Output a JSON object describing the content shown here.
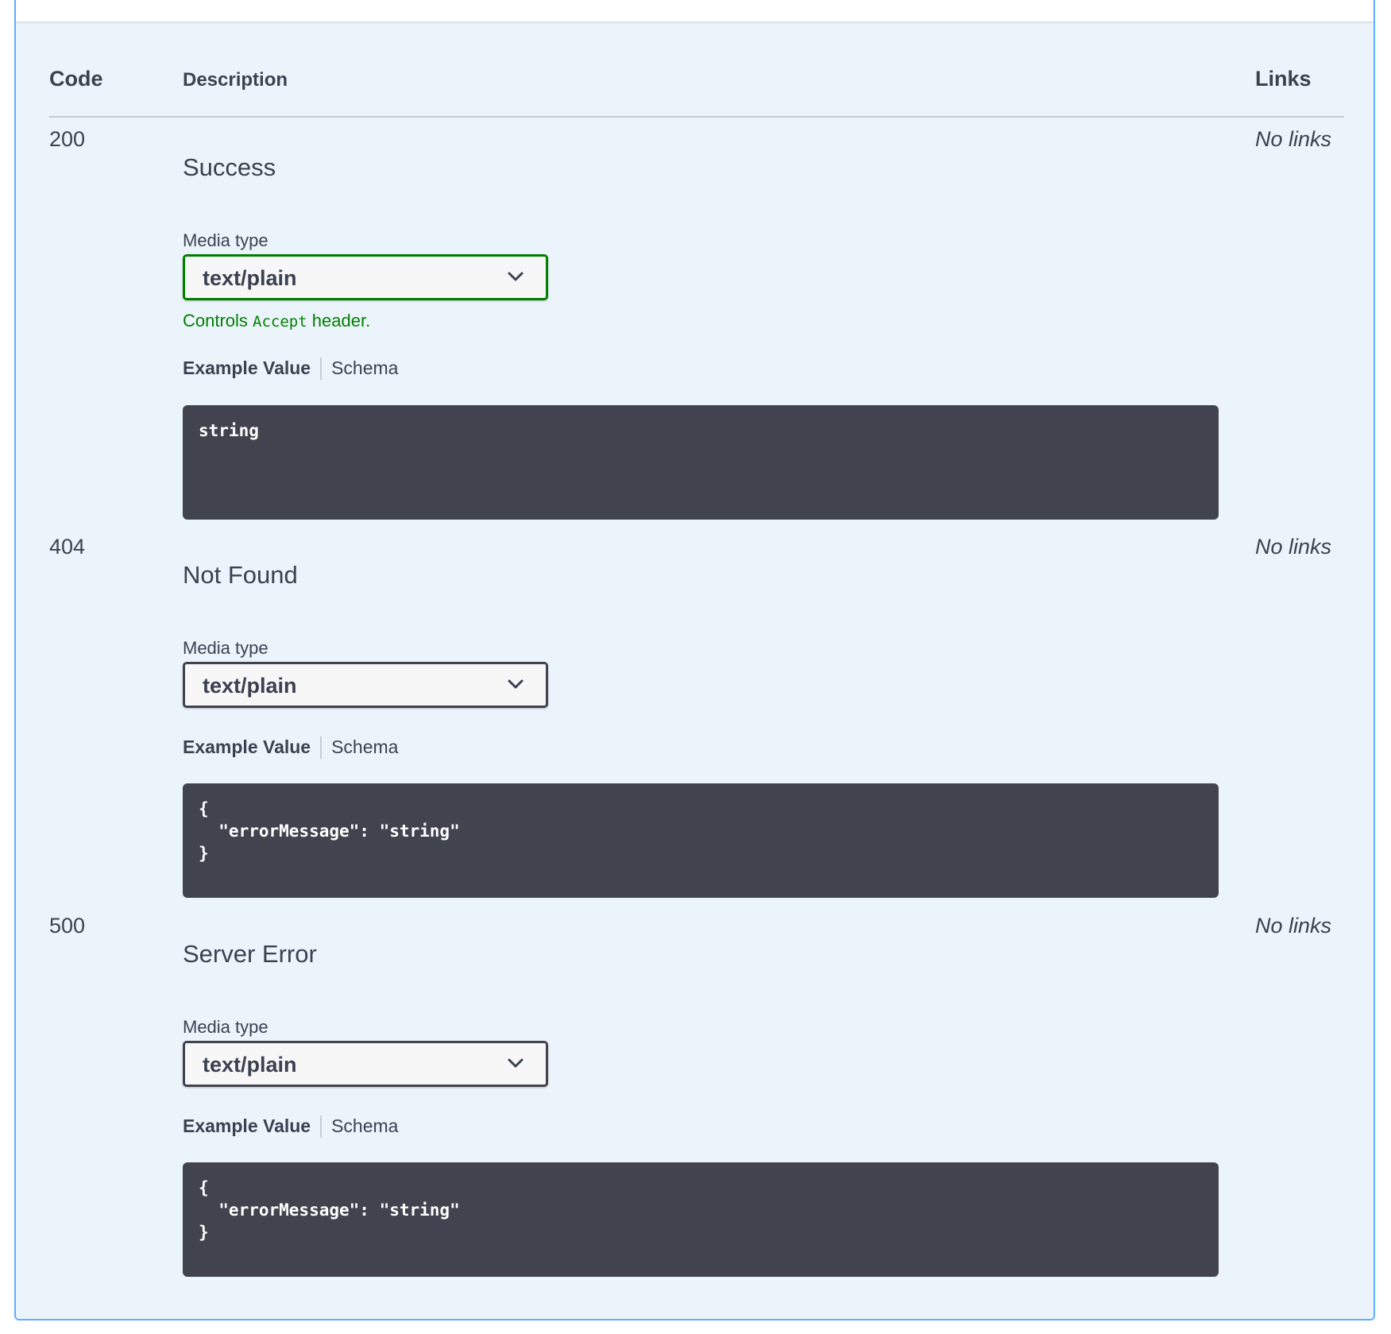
{
  "table": {
    "headers": {
      "code": "Code",
      "description": "Description",
      "links": "Links"
    }
  },
  "responses": [
    {
      "code": "200",
      "description": "Success",
      "links": "No links",
      "media_type_label": "Media type",
      "media_type_value": "text/plain",
      "media_type_active": true,
      "controls_note": {
        "before": "Controls ",
        "code": "Accept",
        "after": " header."
      },
      "tabs": [
        "Example Value",
        "Schema"
      ],
      "example": "string"
    },
    {
      "code": "404",
      "description": "Not Found",
      "links": "No links",
      "media_type_label": "Media type",
      "media_type_value": "text/plain",
      "media_type_active": false,
      "tabs": [
        "Example Value",
        "Schema"
      ],
      "example": "{\n  \"errorMessage\": \"string\"\n}"
    },
    {
      "code": "500",
      "description": "Server Error",
      "links": "No links",
      "media_type_label": "Media type",
      "media_type_value": "text/plain",
      "media_type_active": false,
      "tabs": [
        "Example Value",
        "Schema"
      ],
      "example": "{\n  \"errorMessage\": \"string\"\n}"
    }
  ],
  "icons": {
    "select_chevron": "chevron-down-icon"
  },
  "colors": {
    "panel_background": "#ecf4fb",
    "panel_border": "#61affe",
    "code_block_background": "#41444e",
    "active_select_border": "#008000",
    "controls_note_text": "#008000",
    "text": "#3b4151"
  }
}
